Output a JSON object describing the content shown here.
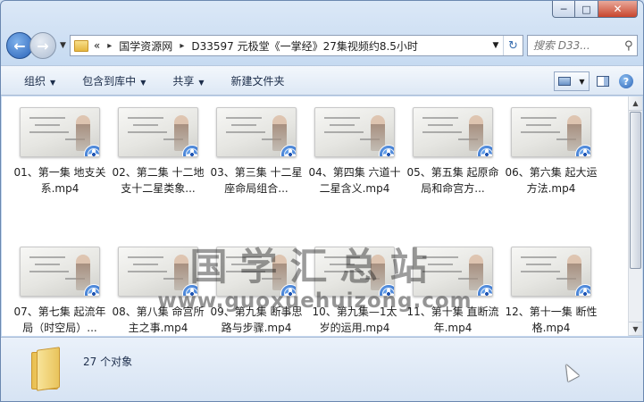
{
  "window": {
    "minimize_label": "─",
    "maximize_label": "□",
    "close_label": "✕"
  },
  "address_bar": {
    "overflow": "«",
    "segments": [
      "国学资源网",
      "D33597 元极堂《一掌经》27集视频约8.5小时"
    ],
    "separator": "▸"
  },
  "search": {
    "placeholder": "搜索 D33..."
  },
  "toolbar": {
    "organize": "组织",
    "include_library": "包含到库中",
    "share": "共享",
    "new_folder": "新建文件夹"
  },
  "files": [
    "01、第一集 地支关系.mp4",
    "02、第二集 十二地支十二星类象...",
    "03、第三集 十二星座命局组合...",
    "04、第四集 六道十二星含义.mp4",
    "05、第五集 起原命局和命宫方...",
    "06、第六集 起大运方法.mp4",
    "07、第七集 起流年局（时空局）...",
    "08、第八集 命宫所主之事.mp4",
    "09、第九集 断事思路与步骤.mp4",
    "10、第九集—1太岁的运用.mp4",
    "11、第十集 直断流年.mp4",
    "12、第十一集 断性格.mp4"
  ],
  "watermark": {
    "title": "国学汇总站",
    "url": "www.guoxuehuizong.com"
  },
  "details": {
    "count": "27 个对象"
  },
  "icons": {
    "file_type": "video-file-icon",
    "folder": "folder-icon"
  }
}
